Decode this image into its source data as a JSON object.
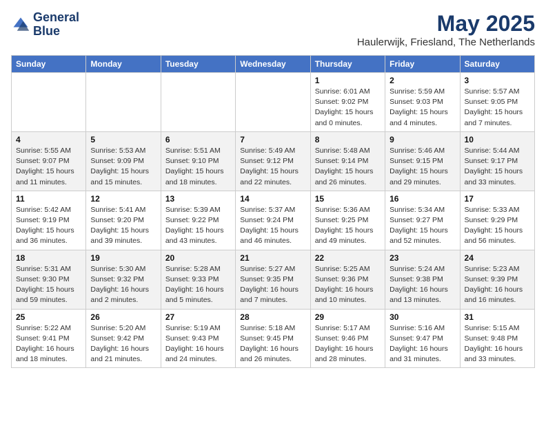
{
  "header": {
    "logo_line1": "General",
    "logo_line2": "Blue",
    "month_year": "May 2025",
    "location": "Haulerwijk, Friesland, The Netherlands"
  },
  "days_of_week": [
    "Sunday",
    "Monday",
    "Tuesday",
    "Wednesday",
    "Thursday",
    "Friday",
    "Saturday"
  ],
  "weeks": [
    [
      {
        "num": "",
        "detail": ""
      },
      {
        "num": "",
        "detail": ""
      },
      {
        "num": "",
        "detail": ""
      },
      {
        "num": "",
        "detail": ""
      },
      {
        "num": "1",
        "detail": "Sunrise: 6:01 AM\nSunset: 9:02 PM\nDaylight: 15 hours\nand 0 minutes."
      },
      {
        "num": "2",
        "detail": "Sunrise: 5:59 AM\nSunset: 9:03 PM\nDaylight: 15 hours\nand 4 minutes."
      },
      {
        "num": "3",
        "detail": "Sunrise: 5:57 AM\nSunset: 9:05 PM\nDaylight: 15 hours\nand 7 minutes."
      }
    ],
    [
      {
        "num": "4",
        "detail": "Sunrise: 5:55 AM\nSunset: 9:07 PM\nDaylight: 15 hours\nand 11 minutes."
      },
      {
        "num": "5",
        "detail": "Sunrise: 5:53 AM\nSunset: 9:09 PM\nDaylight: 15 hours\nand 15 minutes."
      },
      {
        "num": "6",
        "detail": "Sunrise: 5:51 AM\nSunset: 9:10 PM\nDaylight: 15 hours\nand 18 minutes."
      },
      {
        "num": "7",
        "detail": "Sunrise: 5:49 AM\nSunset: 9:12 PM\nDaylight: 15 hours\nand 22 minutes."
      },
      {
        "num": "8",
        "detail": "Sunrise: 5:48 AM\nSunset: 9:14 PM\nDaylight: 15 hours\nand 26 minutes."
      },
      {
        "num": "9",
        "detail": "Sunrise: 5:46 AM\nSunset: 9:15 PM\nDaylight: 15 hours\nand 29 minutes."
      },
      {
        "num": "10",
        "detail": "Sunrise: 5:44 AM\nSunset: 9:17 PM\nDaylight: 15 hours\nand 33 minutes."
      }
    ],
    [
      {
        "num": "11",
        "detail": "Sunrise: 5:42 AM\nSunset: 9:19 PM\nDaylight: 15 hours\nand 36 minutes."
      },
      {
        "num": "12",
        "detail": "Sunrise: 5:41 AM\nSunset: 9:20 PM\nDaylight: 15 hours\nand 39 minutes."
      },
      {
        "num": "13",
        "detail": "Sunrise: 5:39 AM\nSunset: 9:22 PM\nDaylight: 15 hours\nand 43 minutes."
      },
      {
        "num": "14",
        "detail": "Sunrise: 5:37 AM\nSunset: 9:24 PM\nDaylight: 15 hours\nand 46 minutes."
      },
      {
        "num": "15",
        "detail": "Sunrise: 5:36 AM\nSunset: 9:25 PM\nDaylight: 15 hours\nand 49 minutes."
      },
      {
        "num": "16",
        "detail": "Sunrise: 5:34 AM\nSunset: 9:27 PM\nDaylight: 15 hours\nand 52 minutes."
      },
      {
        "num": "17",
        "detail": "Sunrise: 5:33 AM\nSunset: 9:29 PM\nDaylight: 15 hours\nand 56 minutes."
      }
    ],
    [
      {
        "num": "18",
        "detail": "Sunrise: 5:31 AM\nSunset: 9:30 PM\nDaylight: 15 hours\nand 59 minutes."
      },
      {
        "num": "19",
        "detail": "Sunrise: 5:30 AM\nSunset: 9:32 PM\nDaylight: 16 hours\nand 2 minutes."
      },
      {
        "num": "20",
        "detail": "Sunrise: 5:28 AM\nSunset: 9:33 PM\nDaylight: 16 hours\nand 5 minutes."
      },
      {
        "num": "21",
        "detail": "Sunrise: 5:27 AM\nSunset: 9:35 PM\nDaylight: 16 hours\nand 7 minutes."
      },
      {
        "num": "22",
        "detail": "Sunrise: 5:25 AM\nSunset: 9:36 PM\nDaylight: 16 hours\nand 10 minutes."
      },
      {
        "num": "23",
        "detail": "Sunrise: 5:24 AM\nSunset: 9:38 PM\nDaylight: 16 hours\nand 13 minutes."
      },
      {
        "num": "24",
        "detail": "Sunrise: 5:23 AM\nSunset: 9:39 PM\nDaylight: 16 hours\nand 16 minutes."
      }
    ],
    [
      {
        "num": "25",
        "detail": "Sunrise: 5:22 AM\nSunset: 9:41 PM\nDaylight: 16 hours\nand 18 minutes."
      },
      {
        "num": "26",
        "detail": "Sunrise: 5:20 AM\nSunset: 9:42 PM\nDaylight: 16 hours\nand 21 minutes."
      },
      {
        "num": "27",
        "detail": "Sunrise: 5:19 AM\nSunset: 9:43 PM\nDaylight: 16 hours\nand 24 minutes."
      },
      {
        "num": "28",
        "detail": "Sunrise: 5:18 AM\nSunset: 9:45 PM\nDaylight: 16 hours\nand 26 minutes."
      },
      {
        "num": "29",
        "detail": "Sunrise: 5:17 AM\nSunset: 9:46 PM\nDaylight: 16 hours\nand 28 minutes."
      },
      {
        "num": "30",
        "detail": "Sunrise: 5:16 AM\nSunset: 9:47 PM\nDaylight: 16 hours\nand 31 minutes."
      },
      {
        "num": "31",
        "detail": "Sunrise: 5:15 AM\nSunset: 9:48 PM\nDaylight: 16 hours\nand 33 minutes."
      }
    ]
  ]
}
